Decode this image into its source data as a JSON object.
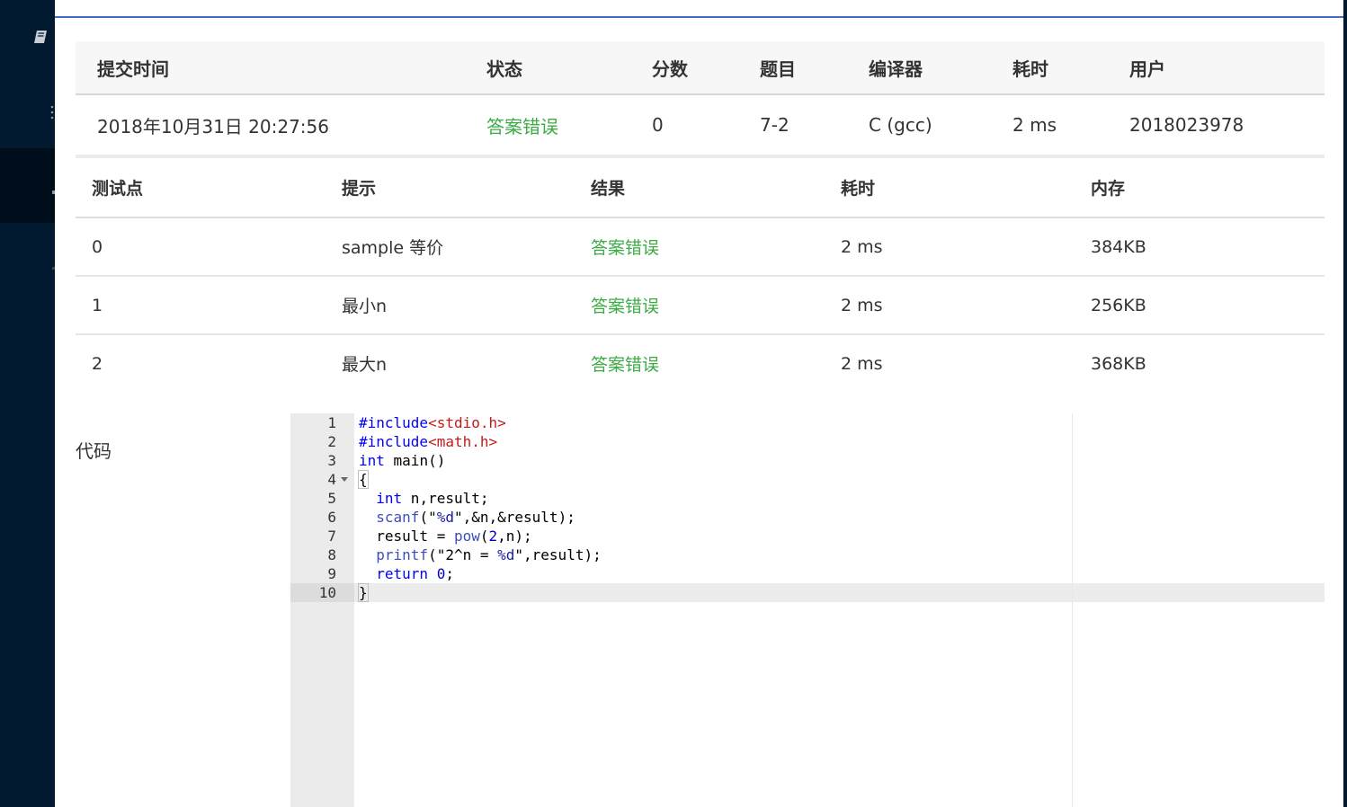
{
  "colors": {
    "sidebar": "#021a30",
    "accent": "#3c6fc2",
    "status_wrong": "#3cab46"
  },
  "submission": {
    "headers": [
      "提交时间",
      "状态",
      "分数",
      "题目",
      "编译器",
      "耗时",
      "用户"
    ],
    "row": {
      "time": "2018年10月31日 20:27:56",
      "status": "答案错误",
      "score": "0",
      "problem": "7-2",
      "compiler": "C (gcc)",
      "duration": "2 ms",
      "user": "2018023978"
    }
  },
  "tests": {
    "headers": [
      "测试点",
      "提示",
      "结果",
      "耗时",
      "内存"
    ],
    "rows": [
      {
        "id": "0",
        "hint": "sample 等价",
        "result": "答案错误",
        "time": "2 ms",
        "memory": "384KB"
      },
      {
        "id": "1",
        "hint": "最小n",
        "result": "答案错误",
        "time": "2 ms",
        "memory": "256KB"
      },
      {
        "id": "2",
        "hint": "最大n",
        "result": "答案错误",
        "time": "2 ms",
        "memory": "368KB"
      }
    ]
  },
  "code_label": "代码",
  "code": {
    "line_numbers": [
      "1",
      "2",
      "3",
      "4",
      "5",
      "6",
      "7",
      "8",
      "9",
      "10"
    ],
    "l1_kw": "#include",
    "l1_str": "<stdio.h>",
    "l2_kw": "#include",
    "l2_str": "<math.h>",
    "l3_kw": "int",
    "l3_rest": " main()",
    "l4": "{",
    "l5_kw": "int",
    "l5_rest": " n,result;",
    "l6_fn": "scanf",
    "l6_a": "(\"",
    "l6_fmt": "%d",
    "l6_b": "\",&n,&result);",
    "l7_a": "result = ",
    "l7_fn": "pow",
    "l7_b": "(",
    "l7_num": "2",
    "l7_c": ",n);",
    "l8_fn": "printf",
    "l8_a": "(\"2^n = ",
    "l8_fmt": "%d",
    "l8_b": "\",result);",
    "l9_kw": "return",
    "l9_num": "0",
    "l9_end": ";",
    "l10": "}"
  }
}
